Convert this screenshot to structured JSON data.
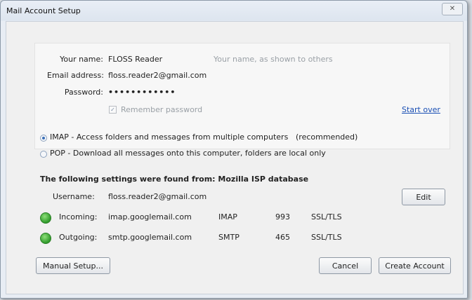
{
  "window": {
    "title": "Mail Account Setup",
    "close_glyph": "✕"
  },
  "identity": {
    "name_label": "Your name:",
    "name_value": "FLOSS Reader",
    "name_hint": "Your name, as shown to others",
    "email_label": "Email address:",
    "email_value": "floss.reader2@gmail.com",
    "password_label": "Password:",
    "password_value": "••••••••••••",
    "remember_label": "Remember password",
    "start_over_link": "Start over"
  },
  "protocols": [
    {
      "label": "IMAP - Access folders and messages from multiple computers",
      "note": "(recommended)",
      "selected": true
    },
    {
      "label": "POP - Download all messages onto this computer, folders are local only",
      "note": "",
      "selected": false
    }
  ],
  "settings": {
    "heading": "The following settings were found from: Mozilla ISP database",
    "username_label": "Username:",
    "username_value": "floss.reader2@gmail.com",
    "edit_button": "Edit",
    "incoming": {
      "label": "Incoming:",
      "server": "imap.googlemail.com",
      "protocol": "IMAP",
      "port": "993",
      "security": "SSL/TLS",
      "status_color": "#2f9a2a"
    },
    "outgoing": {
      "label": "Outgoing:",
      "server": "smtp.googlemail.com",
      "protocol": "SMTP",
      "port": "465",
      "security": "SSL/TLS",
      "status_color": "#2f9a2a"
    }
  },
  "buttons": {
    "manual_setup": "Manual Setup...",
    "cancel": "Cancel",
    "create_account": "Create Account"
  }
}
